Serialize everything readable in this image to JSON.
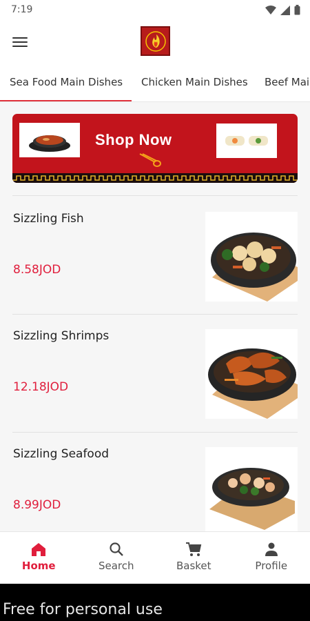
{
  "status": {
    "time": "7:19"
  },
  "tabs": [
    {
      "label": "Sea Food Main Dishes",
      "active": true
    },
    {
      "label": "Chicken Main Dishes",
      "active": false
    },
    {
      "label": "Beef Mai",
      "active": false
    }
  ],
  "banner": {
    "title": "Shop Now"
  },
  "items": [
    {
      "name": "Sizzling Fish",
      "price": "8.58JOD"
    },
    {
      "name": "Sizzling Shrimps",
      "price": "12.18JOD"
    },
    {
      "name": "Sizzling Seafood",
      "price": "8.99JOD"
    }
  ],
  "nav": [
    {
      "label": "Home",
      "icon": "home-icon",
      "active": true
    },
    {
      "label": "Search",
      "icon": "search-icon",
      "active": false
    },
    {
      "label": "Basket",
      "icon": "cart-icon",
      "active": false
    },
    {
      "label": "Profile",
      "icon": "person-icon",
      "active": false
    }
  ],
  "footer": {
    "text": "Free for personal use"
  },
  "colors": {
    "accent": "#e01e3c",
    "banner": "#c2141c",
    "logo": "#b71c1c"
  }
}
